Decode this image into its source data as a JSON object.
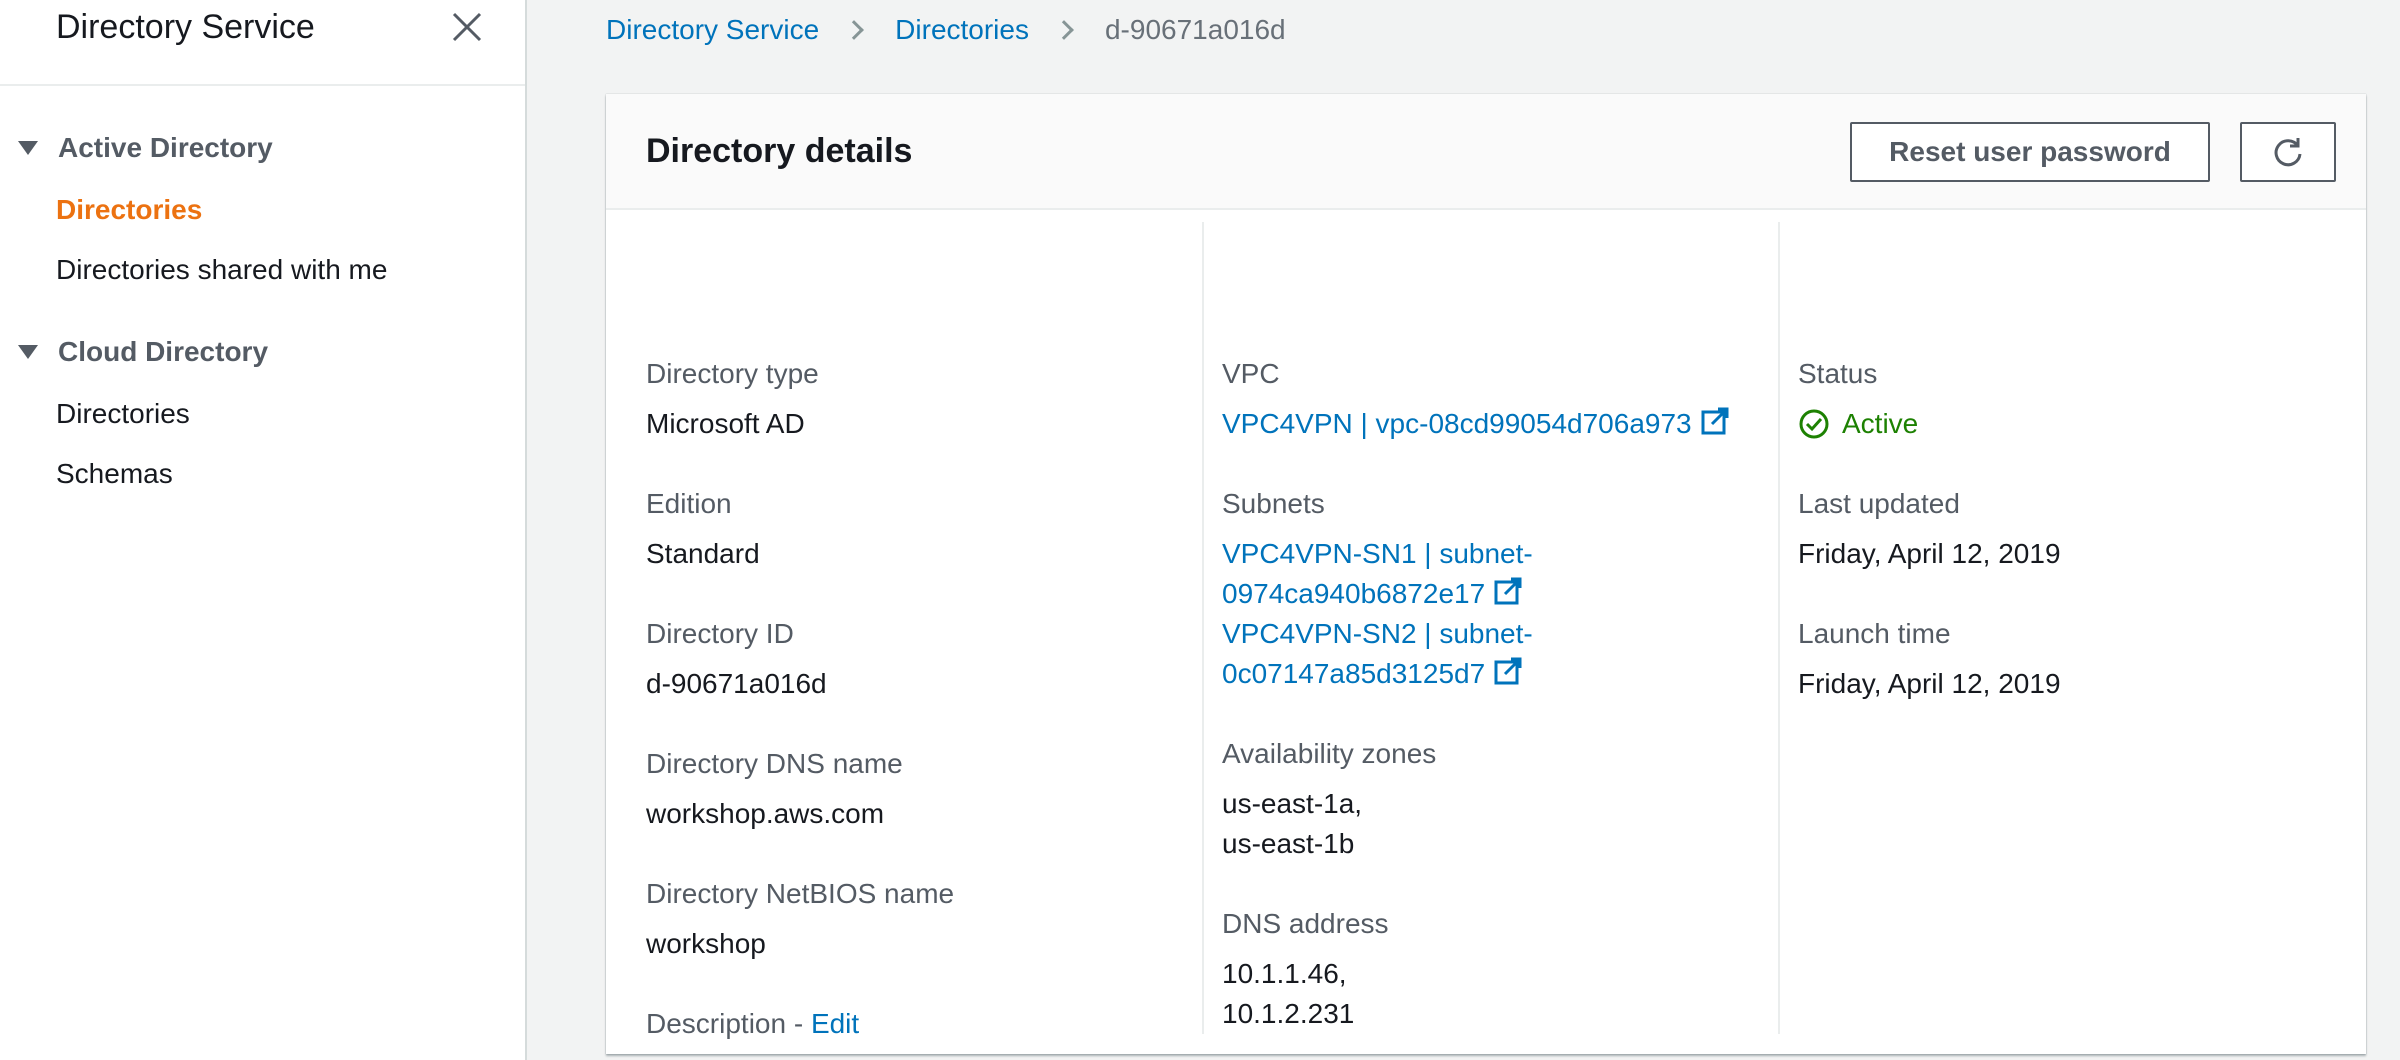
{
  "sidebar": {
    "title": "Directory Service",
    "sections": [
      {
        "label": "Active Directory",
        "items": [
          {
            "label": "Directories",
            "active": true
          },
          {
            "label": "Directories shared with me",
            "active": false
          }
        ]
      },
      {
        "label": "Cloud Directory",
        "items": [
          {
            "label": "Directories",
            "active": false
          },
          {
            "label": "Schemas",
            "active": false
          }
        ]
      }
    ]
  },
  "breadcrumb": {
    "items": [
      "Directory Service",
      "Directories"
    ],
    "current": "d-90671a016d"
  },
  "panel": {
    "title": "Directory details",
    "reset_button": "Reset user password",
    "refresh_icon": "refresh-icon"
  },
  "details": {
    "directory_type": {
      "label": "Directory type",
      "value": "Microsoft AD"
    },
    "edition": {
      "label": "Edition",
      "value": "Standard"
    },
    "directory_id": {
      "label": "Directory ID",
      "value": "d-90671a016d"
    },
    "dns_name": {
      "label": "Directory DNS name",
      "value": "workshop.aws.com"
    },
    "netbios_name": {
      "label": "Directory NetBIOS name",
      "value": "workshop"
    },
    "description": {
      "label": "Description - ",
      "edit": "Edit",
      "value": "-"
    },
    "vpc": {
      "label": "VPC",
      "value": "VPC4VPN | vpc-08cd99054d706a973"
    },
    "subnets": {
      "label": "Subnets",
      "line1a": "VPC4VPN-SN1 | subnet-",
      "line1b": "0974ca940b6872e17",
      "line2a": "VPC4VPN-SN2 | subnet-",
      "line2b": "0c07147a85d3125d7"
    },
    "availability_zones": {
      "label": "Availability zones",
      "line1": "us-east-1a,",
      "line2": "us-east-1b"
    },
    "dns_address": {
      "label": "DNS address",
      "line1": "10.1.1.46,",
      "line2": "10.1.2.231"
    },
    "status": {
      "label": "Status",
      "value": "Active",
      "color": "#1d8102"
    },
    "last_updated": {
      "label": "Last updated",
      "value": "Friday, April 12, 2019"
    },
    "launch_time": {
      "label": "Launch time",
      "value": "Friday, April 12, 2019"
    }
  },
  "colors": {
    "link": "#0073bb",
    "active_nav": "#ec7211",
    "success": "#1d8102"
  }
}
